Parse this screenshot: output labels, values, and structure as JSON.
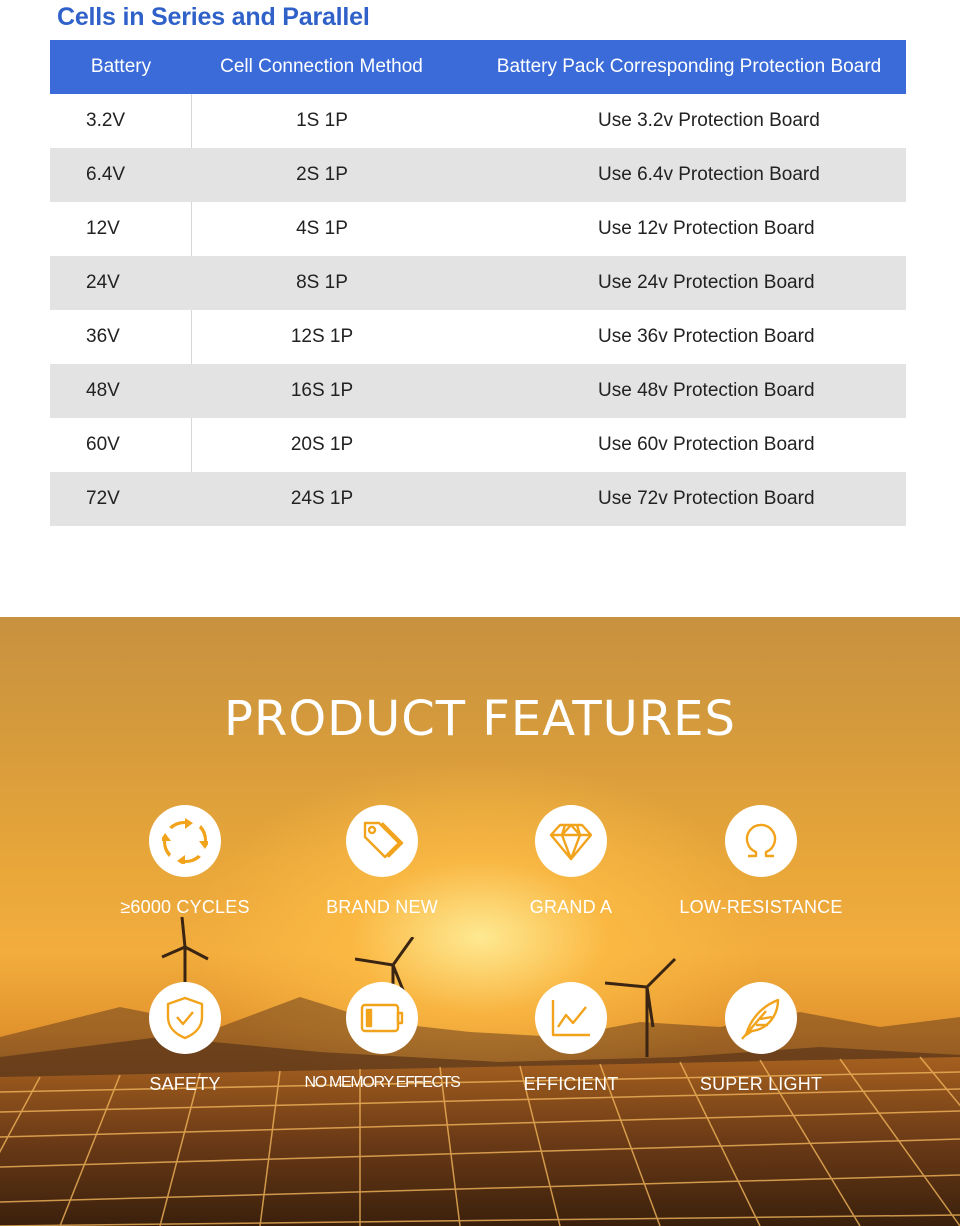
{
  "section_title": "Cells in Series and Parallel",
  "table": {
    "headers": [
      "Battery",
      "Cell Connection Method",
      "Battery Pack Corresponding Protection Board"
    ],
    "rows": [
      {
        "battery": "3.2V",
        "method": "1S  1P",
        "board": "Use 3.2v Protection Board"
      },
      {
        "battery": "6.4V",
        "method": "2S  1P",
        "board": "Use 6.4v Protection Board"
      },
      {
        "battery": "12V",
        "method": "4S  1P",
        "board": "Use 12v Protection Board"
      },
      {
        "battery": "24V",
        "method": "8S  1P",
        "board": "Use 24v Protection Board"
      },
      {
        "battery": "36V",
        "method": "12S 1P",
        "board": "Use 36v Protection Board"
      },
      {
        "battery": "48V",
        "method": "16S 1P",
        "board": "Use 48v Protection Board"
      },
      {
        "battery": "60V",
        "method": "20S 1P",
        "board": "Use 60v Protection Board"
      },
      {
        "battery": "72V",
        "method": "24S 1P",
        "board": "Use 72v Protection Board"
      }
    ]
  },
  "features": {
    "title": "PRODUCT FEATURES",
    "items": [
      {
        "label": "≥6000 CYCLES",
        "icon": "cycle-arrows-icon"
      },
      {
        "label": "BRAND NEW",
        "icon": "tags-icon"
      },
      {
        "label": "GRAND A",
        "icon": "diamond-icon"
      },
      {
        "label": "LOW-RESISTANCE",
        "icon": "omega-icon"
      },
      {
        "label": "SAFETY",
        "icon": "shield-check-icon"
      },
      {
        "label": "NO MEMORY EFFECTS",
        "icon": "battery-icon"
      },
      {
        "label": "EFFICIENT",
        "icon": "line-chart-icon"
      },
      {
        "label": "SUPER LIGHT",
        "icon": "feather-icon"
      }
    ]
  },
  "colors": {
    "title_blue": "#2f61c8",
    "header_blue": "#3a6bd9",
    "stripe_gray": "#e3e3e3",
    "icon_orange": "#f2a31c"
  }
}
